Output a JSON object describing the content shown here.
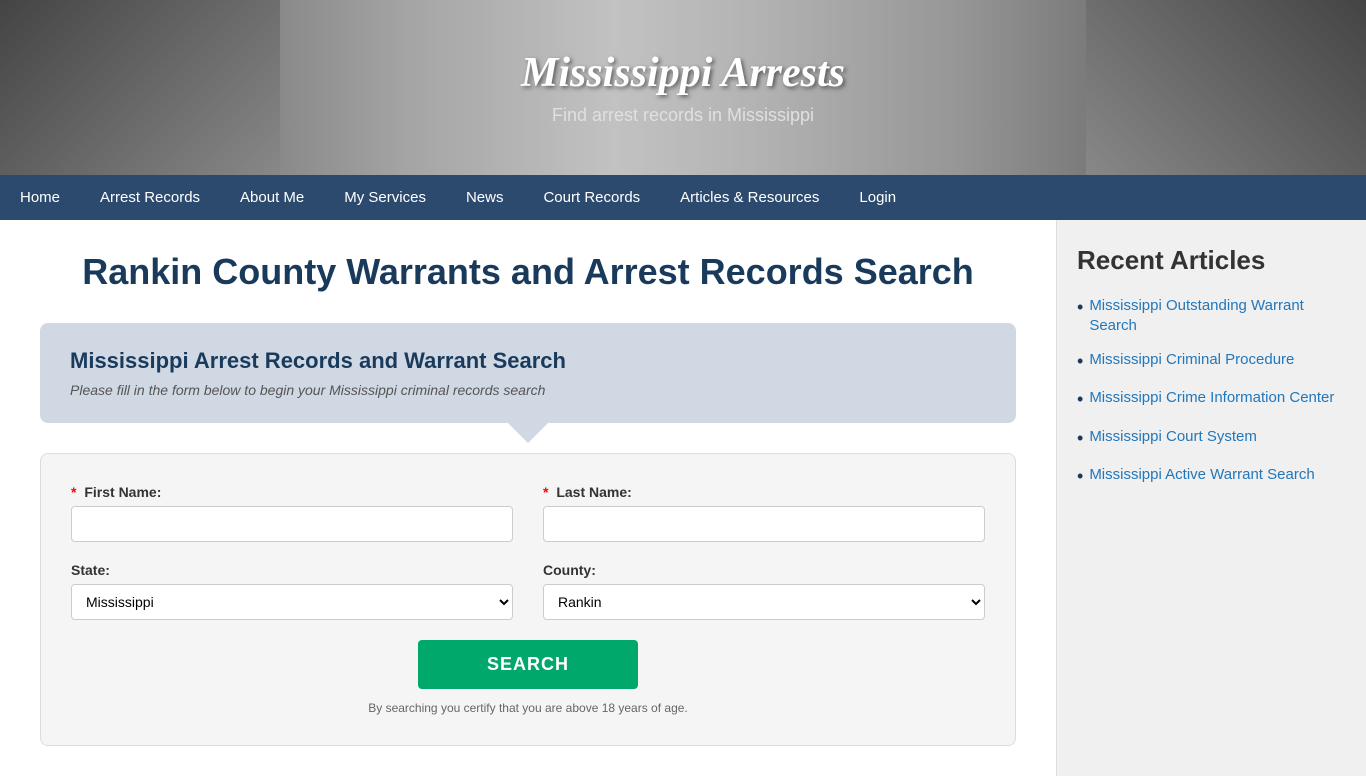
{
  "header": {
    "title": "Mississippi Arrests",
    "subtitle": "Find arrest records in Mississippi"
  },
  "nav": {
    "items": [
      {
        "label": "Home",
        "active": false
      },
      {
        "label": "Arrest Records",
        "active": false
      },
      {
        "label": "About Me",
        "active": false
      },
      {
        "label": "My Services",
        "active": false
      },
      {
        "label": "News",
        "active": false
      },
      {
        "label": "Court Records",
        "active": false
      },
      {
        "label": "Articles & Resources",
        "active": false
      },
      {
        "label": "Login",
        "active": false
      }
    ]
  },
  "content": {
    "page_title": "Rankin County Warrants and Arrest Records Search",
    "search_box": {
      "title": "Mississippi Arrest Records and Warrant Search",
      "subtitle": "Please fill in the form below to begin your Mississippi criminal records search"
    },
    "form": {
      "first_name_label": "First Name:",
      "last_name_label": "Last Name:",
      "state_label": "State:",
      "county_label": "County:",
      "state_default": "Mississippi",
      "county_default": "Rankin",
      "search_button": "SEARCH",
      "disclaimer": "By searching you certify that you are above 18 years of age."
    }
  },
  "sidebar": {
    "title": "Recent Articles",
    "articles": [
      {
        "label": "Mississippi Outstanding Warrant Search",
        "url": "#"
      },
      {
        "label": "Mississippi Criminal Procedure",
        "url": "#"
      },
      {
        "label": "Mississippi Crime Information Center",
        "url": "#"
      },
      {
        "label": "Mississippi Court System",
        "url": "#"
      },
      {
        "label": "Mississippi Active Warrant Search",
        "url": "#"
      }
    ]
  }
}
